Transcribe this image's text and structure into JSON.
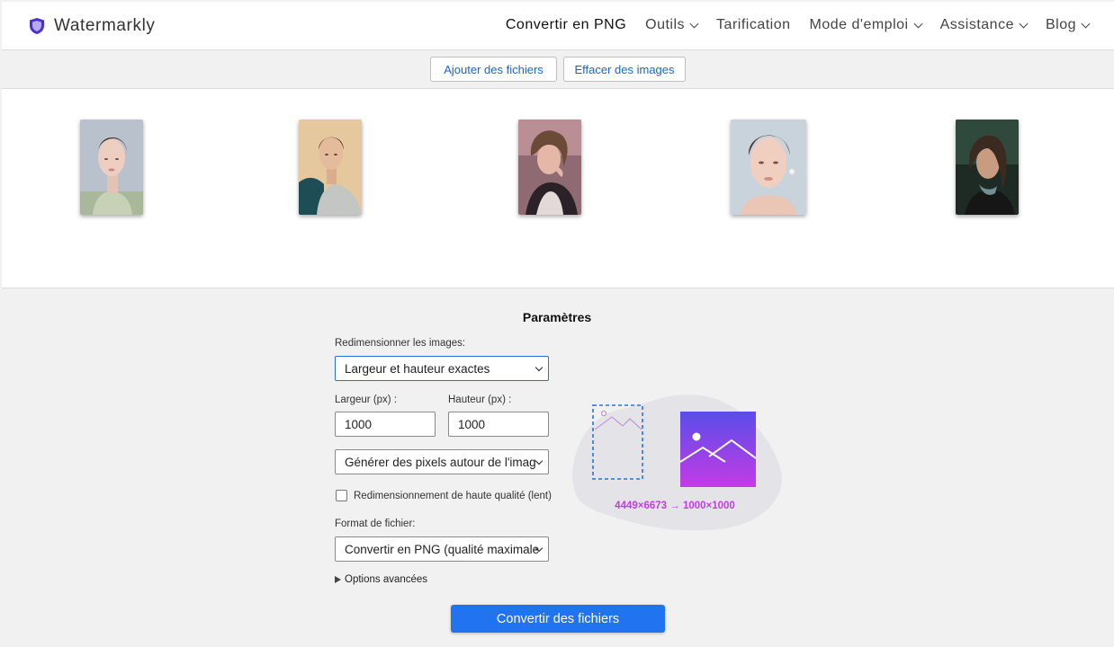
{
  "header": {
    "brand": "Watermarkly",
    "nav": [
      {
        "label": "Convertir en PNG",
        "dropdown": false,
        "active": true
      },
      {
        "label": "Outils",
        "dropdown": true
      },
      {
        "label": "Tarification",
        "dropdown": false
      },
      {
        "label": "Mode d'emploi",
        "dropdown": true
      },
      {
        "label": "Assistance",
        "dropdown": true
      },
      {
        "label": "Blog",
        "dropdown": true
      }
    ],
    "brand_color": "#4b2fcf"
  },
  "toolbar": {
    "add_files": "Ajouter des fichiers",
    "clear_images": "Effacer des images"
  },
  "gallery": {
    "images": [
      "portrait-1",
      "portrait-2",
      "portrait-3",
      "portrait-4",
      "portrait-5"
    ]
  },
  "settings": {
    "title": "Paramètres",
    "resize_label": "Redimensionner les images:",
    "resize_value": "Largeur et hauteur exactes",
    "width_label": "Largeur (px) :",
    "width_value": "1000",
    "height_label": "Hauteur (px) :",
    "height_value": "1000",
    "fill_value": "Générer des pixels autour de l'imag",
    "hq_label": "Redimensionnement de haute qualité (lent)",
    "hq_checked": false,
    "format_label": "Format de fichier:",
    "format_value": "Convertir en PNG (qualité maximale",
    "advanced": "Options avancées",
    "convert_button": "Convertir des fichiers",
    "dimensions": "4449×6673 → 1000×1000"
  },
  "colors": {
    "accent": "#2173f0",
    "link": "#1a66c9",
    "dims": "#c03de0"
  }
}
